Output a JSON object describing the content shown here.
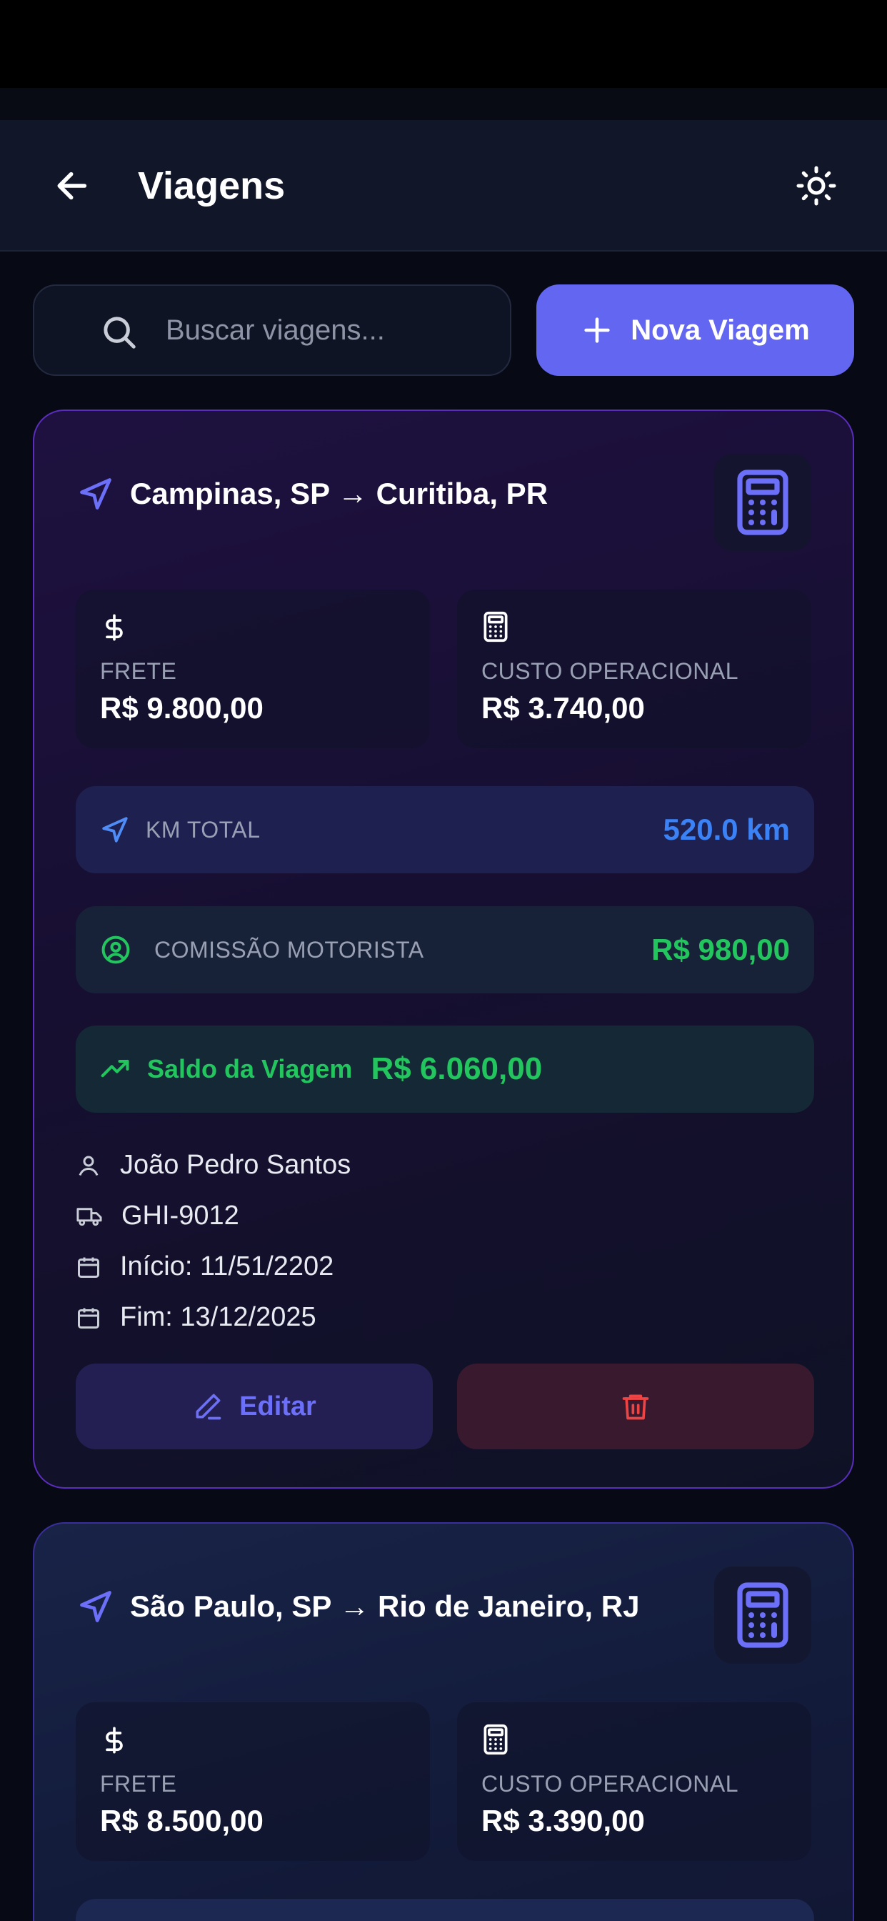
{
  "header": {
    "title": "Viagens"
  },
  "toolbar": {
    "search_placeholder": "Buscar viagens...",
    "new_label": "Nova Viagem"
  },
  "trips": [
    {
      "route": "Campinas, SP → Curitiba, PR",
      "frete_label": "FRETE",
      "frete_value": "R$ 9.800,00",
      "custo_label": "CUSTO OPERACIONAL",
      "custo_value": "R$ 3.740,00",
      "km_label": "KM TOTAL",
      "km_value": "520.0 km",
      "comissao_label": "COMISSÃO MOTORISTA",
      "comissao_value": "R$ 980,00",
      "saldo_label": "Saldo da Viagem",
      "saldo_value": "R$ 6.060,00",
      "driver": "João Pedro Santos",
      "plate": "GHI-9012",
      "start": "Início: 11/51/2202",
      "end": "Fim: 13/12/2025",
      "edit_label": "Editar"
    },
    {
      "route": "São Paulo, SP → Rio de Janeiro, RJ",
      "frete_label": "FRETE",
      "frete_value": "R$ 8.500,00",
      "custo_label": "CUSTO OPERACIONAL",
      "custo_value": "R$ 3.390,00"
    }
  ],
  "colors": {
    "accent": "#6366f1",
    "positive": "#22c55e",
    "km": "#3b82f6",
    "danger": "#ef4444"
  }
}
